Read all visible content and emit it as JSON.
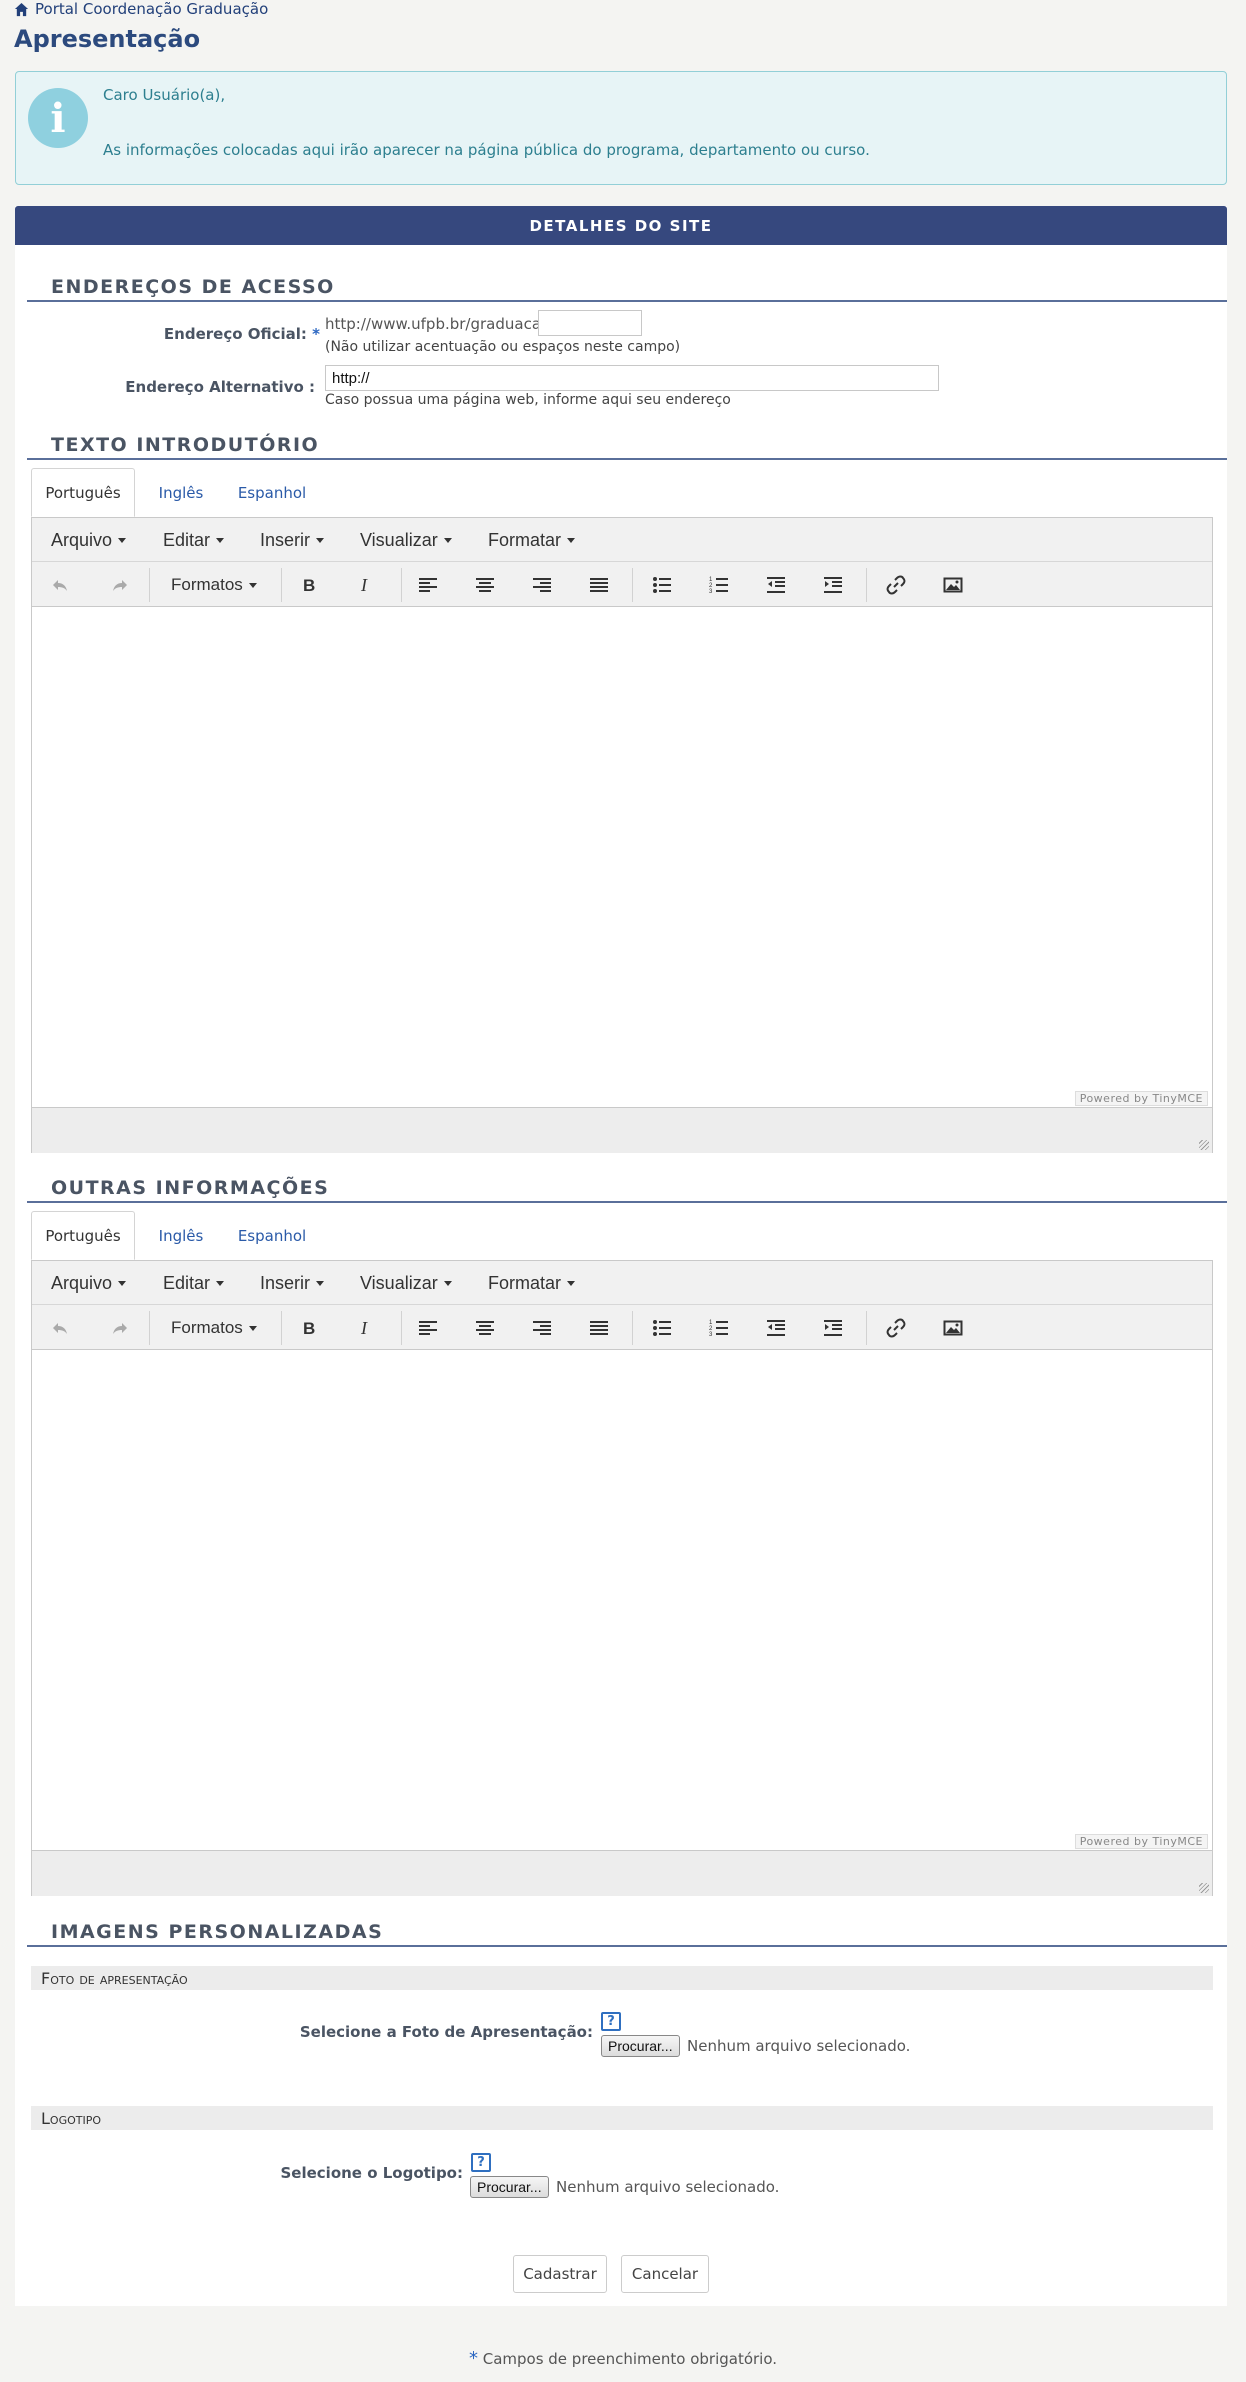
{
  "breadcrumb": {
    "label": "Portal Coordenação Graduação"
  },
  "page": {
    "title": "Apresentação"
  },
  "info": {
    "greeting": "Caro Usuário(a),",
    "message": "As informações colocadas aqui irão aparecer na página pública do programa, departamento ou curso."
  },
  "panel": {
    "title": "DETALHES DO SITE"
  },
  "access": {
    "section_title": "ENDEREÇOS DE ACESSO",
    "official_label": "Endereço Oficial:",
    "required_mark": "*",
    "official_prefix": "http://www.ufpb.br/graduacao/",
    "official_value": "",
    "official_hint": "(Não utilizar acentuação ou espaços neste campo)",
    "alt_label": "Endereço Alternativo :",
    "alt_value": "http://",
    "alt_hint": "Caso possua uma página web, informe aqui seu endereço"
  },
  "intro": {
    "section_title": "TEXTO INTRODUTÓRIO",
    "tabs": [
      "Português",
      "Inglês",
      "Espanhol"
    ],
    "active_tab": 0
  },
  "other": {
    "section_title": "OUTRAS INFORMAÇÕES",
    "tabs": [
      "Português",
      "Inglês",
      "Espanhol"
    ],
    "active_tab": 0
  },
  "editor": {
    "menus": [
      "Arquivo",
      "Editar",
      "Inserir",
      "Visualizar",
      "Formatar"
    ],
    "formats_label": "Formatos",
    "powered_by": "Powered by TinyMCE",
    "icons": [
      "undo-icon",
      "redo-icon",
      "bold-icon",
      "italic-icon",
      "align-left-icon",
      "align-center-icon",
      "align-right-icon",
      "align-justify-icon",
      "bullet-list-icon",
      "numbered-list-icon",
      "outdent-icon",
      "indent-icon",
      "link-icon",
      "image-icon"
    ]
  },
  "images": {
    "section_title": "IMAGENS PERSONALIZADAS",
    "photo_heading": "Foto de apresentação",
    "photo_label": "Selecione a Foto de Apresentação:",
    "logo_heading": "Logotipo",
    "logo_label": "Selecione o Logotipo:",
    "help_text": "?",
    "browse_label": "Procurar...",
    "no_file": "Nenhum arquivo selecionado."
  },
  "actions": {
    "submit": "Cadastrar",
    "cancel": "Cancelar"
  },
  "footer": {
    "required_mark": "*",
    "required_note": "Campos de preenchimento obrigatório."
  },
  "colors": {
    "header_bg": "#36487e",
    "title": "#2c4a7e",
    "info_bg": "#e7f4f6",
    "info_text": "#2d7f8f",
    "link": "#2a5aa8"
  }
}
